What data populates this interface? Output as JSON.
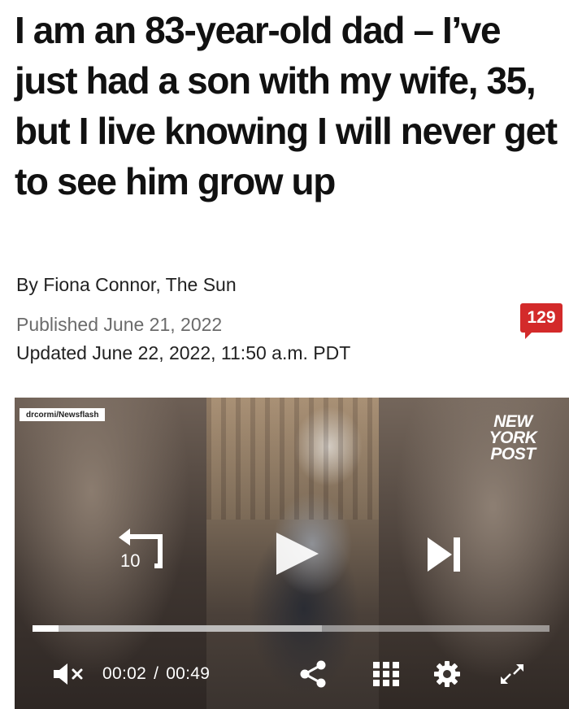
{
  "article": {
    "headline": "I am an 83-year-old dad – I’ve just had a son with my wife, 35, but I live knowing I will never get to see him grow up",
    "byline": "By Fiona Connor, The Sun",
    "published": "Published June 21, 2022",
    "updated": "Updated June 22, 2022, 11:50 a.m. PDT",
    "comment_count": "129"
  },
  "video": {
    "credit": "drcormi/Newsflash",
    "logo_lines": [
      "NEW",
      "YORK",
      "POST"
    ],
    "rewind_seconds": "10",
    "current_time": "00:02",
    "separator": "/",
    "duration": "00:49",
    "progress_fraction": 0.05,
    "buffered_fraction": 0.56
  },
  "icons": {
    "rewind": "rewind-10-icon",
    "play": "play-icon",
    "next": "skip-next-icon",
    "mute": "muted-speaker-icon",
    "share": "share-icon",
    "grid": "grid-icon",
    "settings": "gear-icon",
    "fullscreen": "expand-icon"
  },
  "colors": {
    "comment_badge": "#d32a2a",
    "headline": "#111111",
    "meta_gray": "#6b6b6b"
  }
}
